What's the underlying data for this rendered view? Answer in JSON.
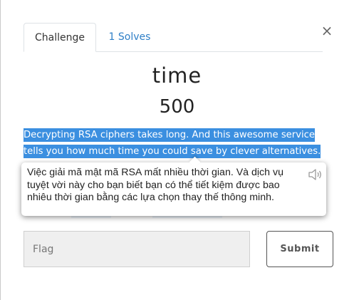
{
  "tabs": [
    {
      "label": "Challenge"
    },
    {
      "label": "1 Solves"
    }
  ],
  "close_glyph": "×",
  "challenge": {
    "name": "time",
    "points": "500",
    "description": "Decrypting RSA ciphers takes long. And this awesome service tells you how much time you could save by clever alternatives."
  },
  "translation_tooltip": {
    "text": "Việc giải mã mật mã RSA mất nhiều thời gian. Và dịch vụ tuyệt vời này cho bạn biết bạn có thể tiết kiệm được bao nhiêu thời gian bằng các lựa chọn thay thế thông minh.",
    "icon": "speaker-icon"
  },
  "flag_input": {
    "placeholder": "Flag",
    "value": ""
  },
  "submit_label": "Submit",
  "colors": {
    "highlight": "#3b8fe0",
    "link": "#2f7fc7",
    "input_bg": "#efefef"
  }
}
